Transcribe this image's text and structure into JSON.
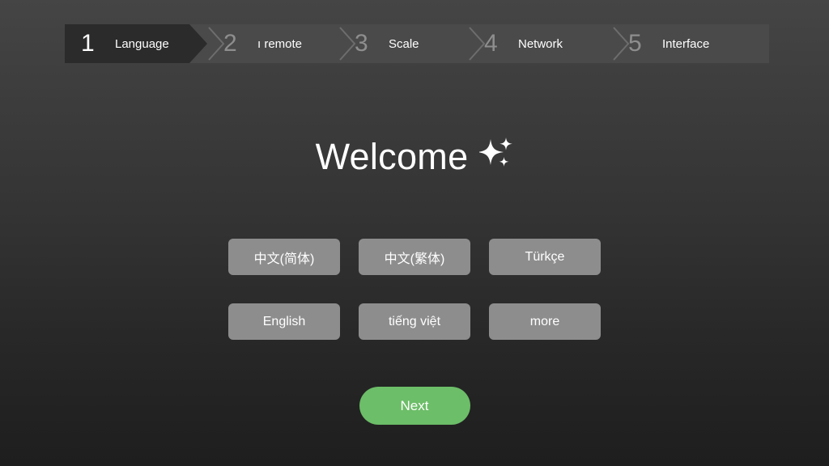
{
  "stepper": {
    "steps": [
      {
        "number": "1",
        "label": "Language",
        "active": true
      },
      {
        "number": "2",
        "label": "ı remote",
        "active": false
      },
      {
        "number": "3",
        "label": "Scale",
        "active": false
      },
      {
        "number": "4",
        "label": "Network",
        "active": false
      },
      {
        "number": "5",
        "label": "Interface",
        "active": false
      }
    ]
  },
  "headline": {
    "title": "Welcome",
    "icon": "sparkles-icon"
  },
  "languages": {
    "row1": [
      {
        "label": "中文(简体)"
      },
      {
        "label": "中文(繁体)"
      },
      {
        "label": "Türkçe"
      }
    ],
    "row2": [
      {
        "label": "English"
      },
      {
        "label": "tiếng việt"
      },
      {
        "label": "more"
      }
    ]
  },
  "actions": {
    "next_label": "Next"
  },
  "colors": {
    "accent_green": "#6cbe68",
    "bar_background": "#4a4a4a",
    "active_step": "#2b2b2b",
    "language_button": "#8d8d8d",
    "page_top": "#454545",
    "page_bottom": "#1e1e1e"
  }
}
